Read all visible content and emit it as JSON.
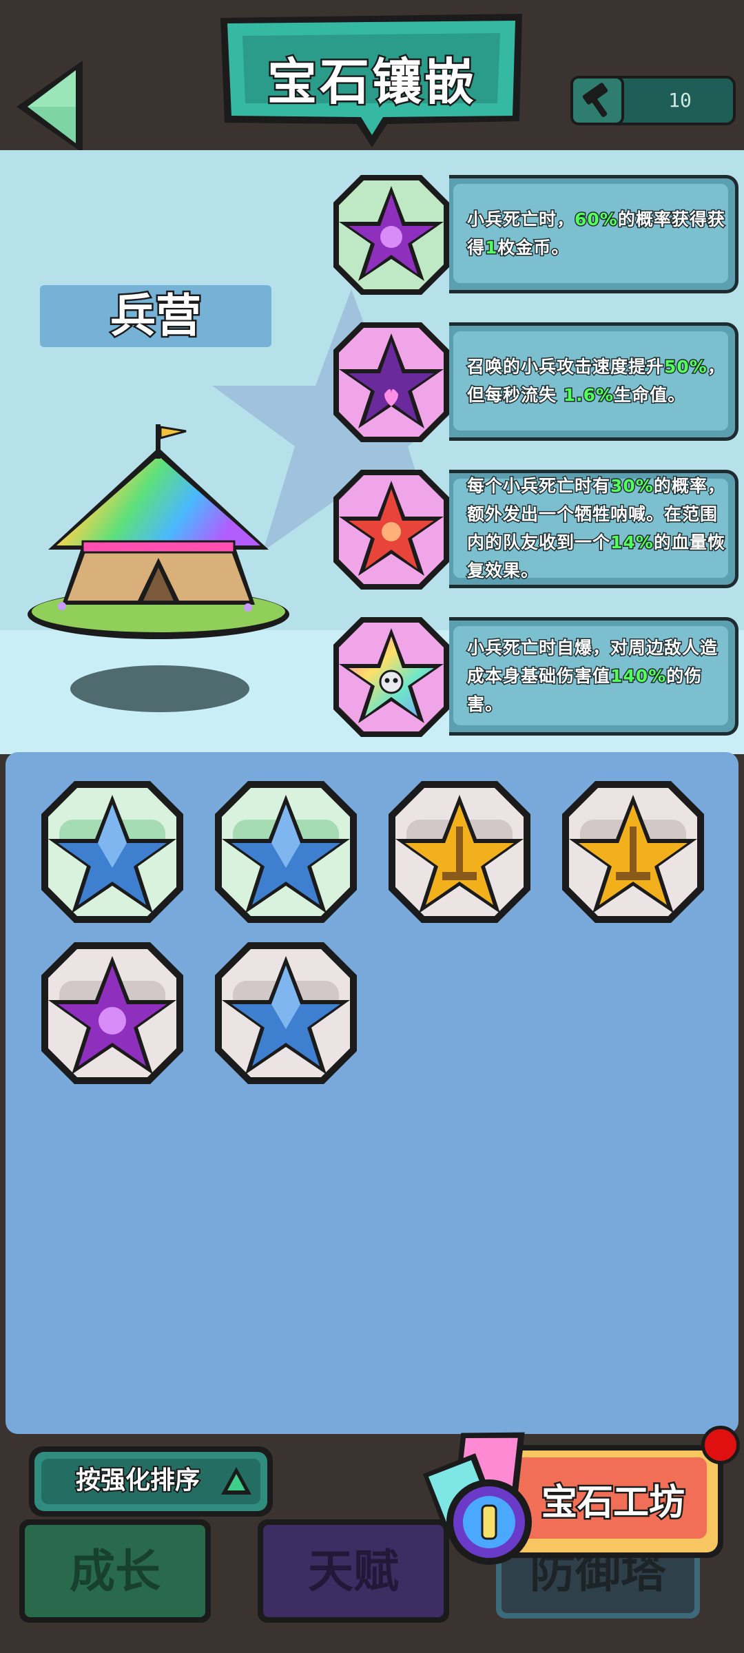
{
  "header": {
    "title": "宝石镶嵌",
    "hammer_count": "10"
  },
  "building": {
    "name": "兵营"
  },
  "effects": [
    {
      "gem": "purple-recycle-star",
      "parts": [
        {
          "t": "小兵死亡时，"
        },
        {
          "t": "60%",
          "hl": true
        },
        {
          "t": "的概率获得获得"
        },
        {
          "t": "1",
          "hl": true
        },
        {
          "t": "枚金币。"
        }
      ]
    },
    {
      "gem": "purple-heart-star",
      "parts": [
        {
          "t": "召唤的小兵攻击速度提升"
        },
        {
          "t": "50%",
          "hl": true
        },
        {
          "t": "，但每秒流失 "
        },
        {
          "t": "1.6%",
          "hl": true
        },
        {
          "t": "生命值。"
        }
      ]
    },
    {
      "gem": "red-horn-star",
      "parts": [
        {
          "t": "每个小兵死亡时有"
        },
        {
          "t": "30%",
          "hl": true
        },
        {
          "t": "的概率，额外发出一个牺牲呐喊。在范围内的队友收到一个"
        },
        {
          "t": "14%",
          "hl": true
        },
        {
          "t": "的血量恢复效果。"
        }
      ]
    },
    {
      "gem": "rainbow-skull-star",
      "parts": [
        {
          "t": "小兵死亡时自爆，对周边敌人造成本身基础伤害值"
        },
        {
          "t": "140%",
          "hl": true
        },
        {
          "t": "的伤害。"
        }
      ]
    }
  ],
  "inventory": [
    {
      "gem": "blue-sword-star",
      "frame": "green"
    },
    {
      "gem": "blue-sword-star",
      "frame": "green"
    },
    {
      "gem": "gold-sword-star",
      "frame": "grey"
    },
    {
      "gem": "gold-sword-star",
      "frame": "grey"
    },
    {
      "gem": "purple-recycle-star",
      "frame": "grey"
    },
    {
      "gem": "blue-sword-star",
      "frame": "grey"
    }
  ],
  "sort": {
    "label": "按强化排序"
  },
  "tabs": [
    {
      "label": "成长"
    },
    {
      "label": "天赋"
    },
    {
      "label": "防御塔"
    }
  ],
  "workshop": {
    "label": "宝石工坊"
  },
  "colors": {
    "highlight": "#53ff5b",
    "panel": "#79a9da",
    "teal": "#2f8c7e"
  }
}
